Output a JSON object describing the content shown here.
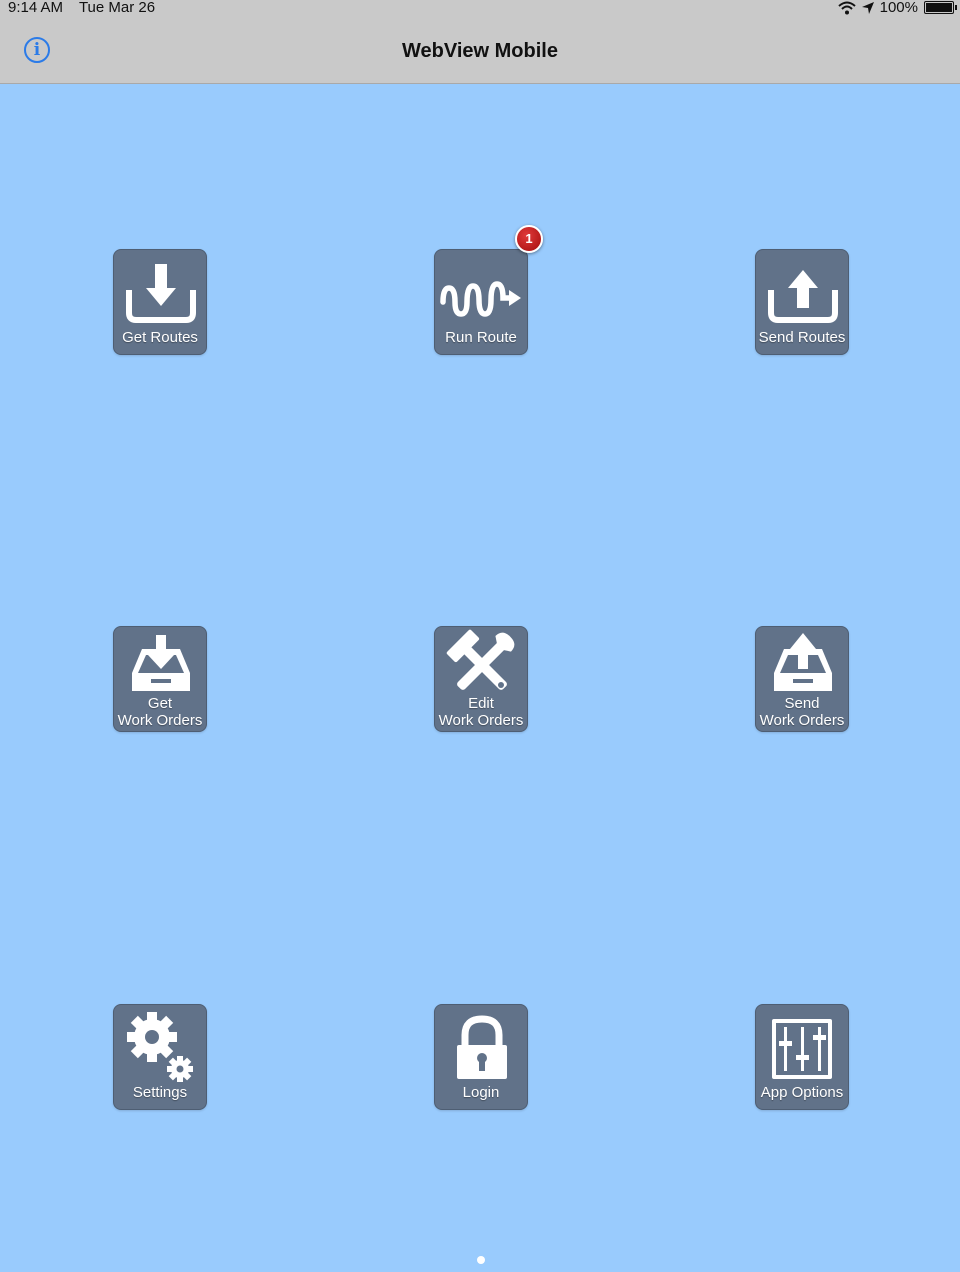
{
  "status_bar": {
    "time": "9:14 AM",
    "date": "Tue Mar 26",
    "battery": "100%"
  },
  "nav": {
    "title": "WebView Mobile",
    "info_icon": "i"
  },
  "tiles": [
    {
      "icon": "download-tray-icon",
      "label": "Get Routes"
    },
    {
      "icon": "route-squiggle-icon",
      "label": "Run Route",
      "badge": "1"
    },
    {
      "icon": "upload-tray-icon",
      "label": "Send Routes"
    },
    {
      "icon": "inbox-download-icon",
      "label_line1": "Get",
      "label_line2": "Work Orders"
    },
    {
      "icon": "wrench-hammer-icon",
      "label_line1": "Edit",
      "label_line2": "Work Orders"
    },
    {
      "icon": "inbox-upload-icon",
      "label_line1": "Send",
      "label_line2": "Work Orders"
    },
    {
      "icon": "gears-icon",
      "label": "Settings"
    },
    {
      "icon": "padlock-icon",
      "label": "Login"
    },
    {
      "icon": "sliders-icon",
      "label": "App Options"
    }
  ],
  "colors": {
    "background": "#99cbfd",
    "tile": "#617289",
    "badge": "#c0161a",
    "info_icon": "#2b7be8"
  },
  "pager": {
    "pages": 1,
    "current": 1
  }
}
